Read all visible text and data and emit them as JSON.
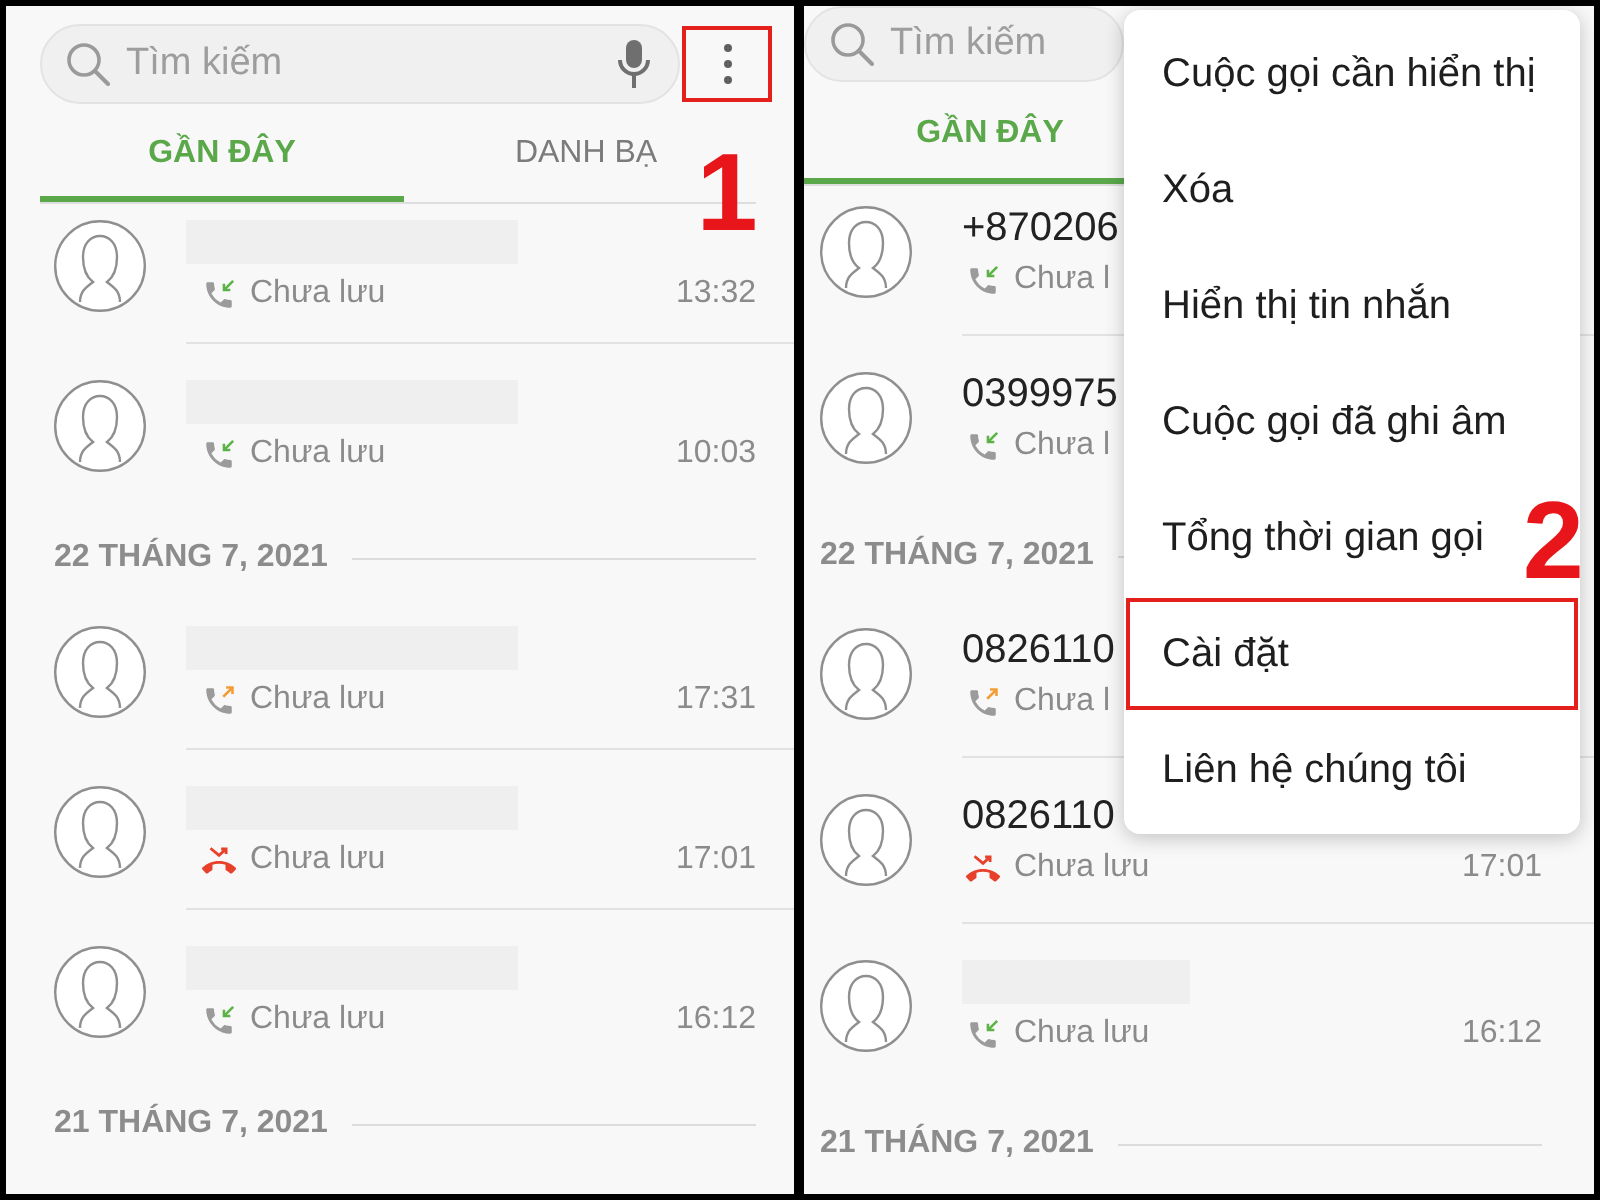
{
  "panels": [
    {
      "search": {
        "placeholder": "Tìm kiếm"
      },
      "more_button": {
        "highlighted": true,
        "callout": "1"
      },
      "tabs": [
        {
          "label": "GẦN ĐÂY",
          "selected": true
        },
        {
          "label": "DANH BẠ",
          "selected": false
        }
      ],
      "sections": [
        {
          "rows": [
            {
              "kind": "incoming",
              "status": "Chưa lưu",
              "time": "13:32"
            },
            {
              "kind": "incoming",
              "status": "Chưa lưu",
              "time": "10:03"
            }
          ]
        },
        {
          "date": "22 THÁNG 7, 2021",
          "rows": [
            {
              "kind": "outgoing",
              "status": "Chưa lưu",
              "time": "17:31"
            },
            {
              "kind": "missed",
              "status": "Chưa lưu",
              "time": "17:01"
            },
            {
              "kind": "incoming",
              "status": "Chưa lưu",
              "time": "16:12"
            }
          ]
        },
        {
          "date": "21 THÁNG 7, 2021"
        }
      ]
    },
    {
      "search": {
        "placeholder": "Tìm kiếm"
      },
      "tabs": [
        {
          "label": "GẦN ĐÂY",
          "selected": true
        }
      ],
      "sections": [
        {
          "rows": [
            {
              "kind": "incoming",
              "name": "+870206",
              "status": "Chưa l"
            },
            {
              "kind": "incoming",
              "name": "0399975",
              "status": "Chưa l"
            }
          ]
        },
        {
          "date": "22 THÁNG 7, 2021",
          "rows": [
            {
              "kind": "outgoing",
              "name": "0826110",
              "status": "Chưa l"
            },
            {
              "kind": "missed",
              "name": "0826110",
              "status": "Chưa lưu",
              "time": "17:01"
            },
            {
              "kind": "incoming",
              "status": "Chưa lưu",
              "time": "16:12"
            }
          ]
        },
        {
          "date": "21 THÁNG 7, 2021"
        }
      ],
      "menu": {
        "items": [
          {
            "label": "Cuộc gọi cần hiển thị",
            "highlighted": false
          },
          {
            "label": "Xóa",
            "highlighted": false
          },
          {
            "label": "Hiển thị tin nhắn",
            "highlighted": false
          },
          {
            "label": "Cuộc gọi đã ghi âm",
            "highlighted": false
          },
          {
            "label": "Tổng thời gian gọi",
            "highlighted": false
          },
          {
            "label": "Cài đặt",
            "highlighted": true,
            "callout": "2"
          },
          {
            "label": "Liên hệ chúng tôi",
            "highlighted": false
          }
        ]
      }
    }
  ]
}
